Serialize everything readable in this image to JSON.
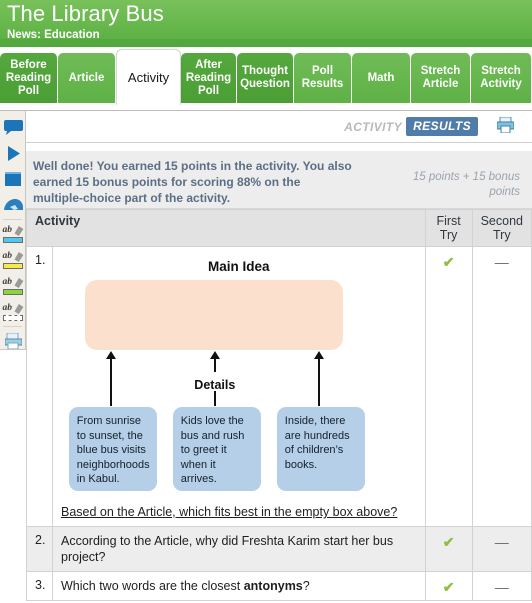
{
  "header": {
    "title": "The Library Bus",
    "subtitle": "News: Education"
  },
  "tabs": [
    {
      "label": "Before Reading Poll",
      "active": false
    },
    {
      "label": "Article",
      "active": false
    },
    {
      "label": "Activity",
      "active": true
    },
    {
      "label": "After Reading Poll",
      "active": false
    },
    {
      "label": "Thought Question",
      "active": false
    },
    {
      "label": "Poll Results",
      "active": false
    },
    {
      "label": "Math",
      "active": false
    },
    {
      "label": "Stretch Article",
      "active": false
    },
    {
      "label": "Stretch Activity",
      "active": false
    }
  ],
  "toolbar": {
    "tools": [
      {
        "name": "comment-icon",
        "label": "Comment"
      },
      {
        "name": "play-icon",
        "label": "Play"
      },
      {
        "name": "stop-icon",
        "label": "Stop"
      },
      {
        "name": "eraser-icon",
        "label": "Eraser"
      },
      {
        "name": "highlighter-cyan-icon",
        "label": "Cyan Highlighter",
        "color": "#4ec8ef"
      },
      {
        "name": "highlighter-yellow-icon",
        "label": "Yellow Highlighter",
        "color": "#f5ea48"
      },
      {
        "name": "highlighter-green-icon",
        "label": "Green Highlighter",
        "color": "#8cd63c"
      },
      {
        "name": "highlighter-clear-icon",
        "label": "Clear Highlighter",
        "color": "#ffffff"
      },
      {
        "name": "print-page-icon",
        "label": "Print Page"
      }
    ]
  },
  "mode_strip": {
    "activity_label": "ACTIVITY",
    "results_label": "RESULTS",
    "print_label": "Print"
  },
  "score": {
    "message": "Well done! You earned 15 points in the activity. You also earned 15 bonus points for scoring 88% on the multiple-choice part of the activity.",
    "points_note": "15 points + 15 bonus points"
  },
  "table": {
    "headers": {
      "activity": "Activity",
      "first_try": "First Try",
      "second_try": "Second Try"
    },
    "rows": [
      {
        "number": "1.",
        "question": "Based on the Article, which fits best in the empty box above?",
        "first_try": "✔",
        "second_try": "—",
        "has_diagram": true
      },
      {
        "number": "2.",
        "question": "According to the Article, why did Freshta Karim start her bus project?",
        "first_try": "✔",
        "second_try": "—",
        "has_diagram": false
      },
      {
        "number": "3.",
        "question_prefix": "Which two words are the closest ",
        "question_bold": "antonyms",
        "question_suffix": "?",
        "first_try": "✔",
        "second_try": "—",
        "has_diagram": false
      }
    ]
  },
  "diagram": {
    "main_idea_label": "Main Idea",
    "main_idea_text": "",
    "details_label": "Details",
    "details": [
      "From sunrise to sunset, the blue bus visits neighborhoods in Kabul.",
      "Kids love the bus and rush to greet it when it arrives.",
      "Inside, there are hundreds of children’s books."
    ]
  },
  "colors": {
    "brand_green": "#57ad3e",
    "tab_green": "#4a9e34",
    "results_blue": "#4f7ca8",
    "main_idea_box": "#fbe0cd",
    "detail_box": "#b4cfe7",
    "check_green": "#8fbf3f",
    "score_text": "#5b6f86"
  }
}
